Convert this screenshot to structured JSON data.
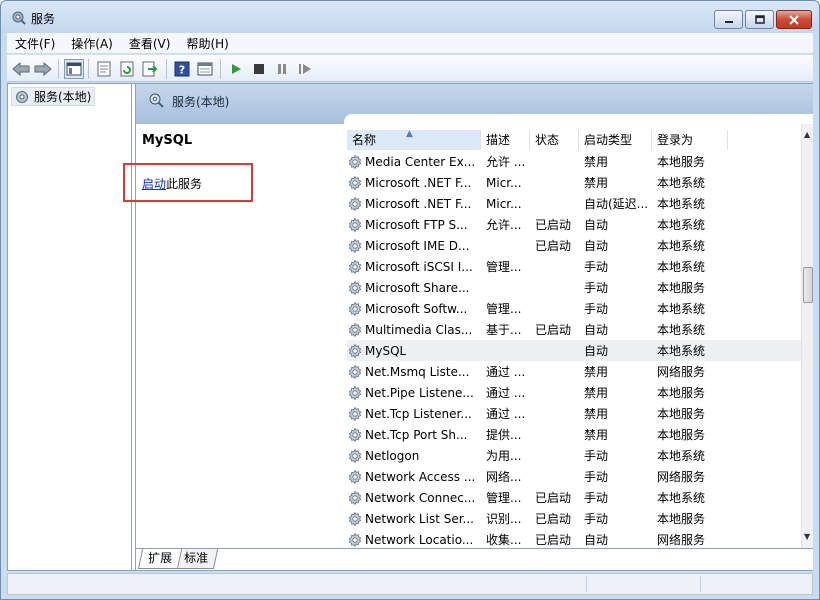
{
  "window": {
    "title": "服务"
  },
  "menu": [
    {
      "label": "文件(F)"
    },
    {
      "label": "操作(A)"
    },
    {
      "label": "查看(V)"
    },
    {
      "label": "帮助(H)"
    }
  ],
  "toolbar": {
    "buttons": [
      "back-arrow-icon",
      "forward-arrow-icon",
      "console-tree-icon",
      "properties-icon",
      "refresh-icon",
      "export-list-icon",
      "help-icon",
      "view-icon",
      "play-icon",
      "stop-icon",
      "pause-icon",
      "resume-icon"
    ]
  },
  "tree": {
    "root_label": "服务(本地)"
  },
  "pane": {
    "header_title": "服务(本地)",
    "selected_service": "MySQL",
    "start_link": "启动",
    "start_suffix": "此服务"
  },
  "list": {
    "columns": [
      "名称",
      "描述",
      "状态",
      "启动类型",
      "登录为"
    ],
    "rows": [
      {
        "name": "Media Center Ex...",
        "desc": "允许 ...",
        "status": "",
        "start": "禁用",
        "logon": "本地服务"
      },
      {
        "name": "Microsoft .NET F...",
        "desc": "Micr...",
        "status": "",
        "start": "禁用",
        "logon": "本地系统"
      },
      {
        "name": "Microsoft .NET F...",
        "desc": "Micr...",
        "status": "",
        "start": "自动(延迟...",
        "logon": "本地系统"
      },
      {
        "name": "Microsoft FTP S...",
        "desc": "允许...",
        "status": "已启动",
        "start": "自动",
        "logon": "本地系统"
      },
      {
        "name": "Microsoft IME D...",
        "desc": "",
        "status": "已启动",
        "start": "自动",
        "logon": "本地系统"
      },
      {
        "name": "Microsoft iSCSI I...",
        "desc": "管理...",
        "status": "",
        "start": "手动",
        "logon": "本地系统"
      },
      {
        "name": "Microsoft Share...",
        "desc": "",
        "status": "",
        "start": "手动",
        "logon": "本地服务"
      },
      {
        "name": "Microsoft Softw...",
        "desc": "管理...",
        "status": "",
        "start": "手动",
        "logon": "本地系统"
      },
      {
        "name": "Multimedia Clas...",
        "desc": "基于...",
        "status": "已启动",
        "start": "自动",
        "logon": "本地系统"
      },
      {
        "name": "MySQL",
        "desc": "",
        "status": "",
        "start": "自动",
        "logon": "本地系统"
      },
      {
        "name": "Net.Msmq Liste...",
        "desc": "通过 ...",
        "status": "",
        "start": "禁用",
        "logon": "网络服务"
      },
      {
        "name": "Net.Pipe Listene...",
        "desc": "通过 ...",
        "status": "",
        "start": "禁用",
        "logon": "本地服务"
      },
      {
        "name": "Net.Tcp Listener...",
        "desc": "通过 ...",
        "status": "",
        "start": "禁用",
        "logon": "本地服务"
      },
      {
        "name": "Net.Tcp Port Sh...",
        "desc": "提供...",
        "status": "",
        "start": "禁用",
        "logon": "本地服务"
      },
      {
        "name": "Netlogon",
        "desc": "为用...",
        "status": "",
        "start": "手动",
        "logon": "本地系统"
      },
      {
        "name": "Network Access ...",
        "desc": "网络...",
        "status": "",
        "start": "手动",
        "logon": "网络服务"
      },
      {
        "name": "Network Connec...",
        "desc": "管理...",
        "status": "已启动",
        "start": "手动",
        "logon": "本地系统"
      },
      {
        "name": "Network List Ser...",
        "desc": "识别...",
        "status": "已启动",
        "start": "手动",
        "logon": "本地服务"
      },
      {
        "name": "Network Locatio...",
        "desc": "收集...",
        "status": "已启动",
        "start": "自动",
        "logon": "网络服务"
      }
    ],
    "selected_index": 9
  },
  "tabs": [
    {
      "label": "扩展"
    },
    {
      "label": "标准"
    }
  ],
  "colors": {
    "accent": "#0b34b8",
    "highlight": "#d53c3c",
    "header": "#a7c0dc"
  }
}
